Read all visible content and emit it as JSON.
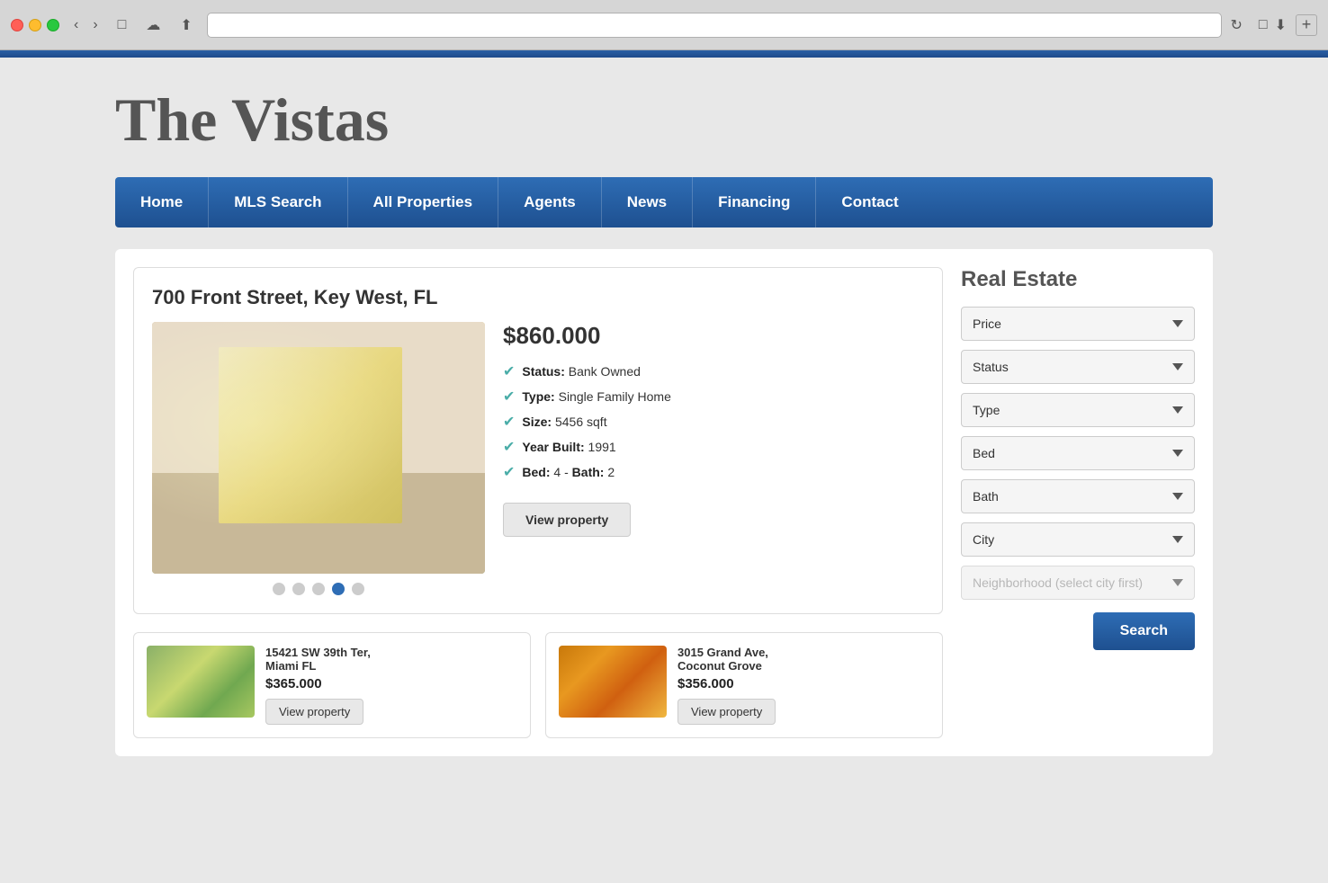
{
  "browser": {
    "address": ""
  },
  "site": {
    "title": "The Vistas"
  },
  "nav": {
    "items": [
      {
        "id": "home",
        "label": "Home"
      },
      {
        "id": "mls-search",
        "label": "MLS Search"
      },
      {
        "id": "all-properties",
        "label": "All Properties"
      },
      {
        "id": "agents",
        "label": "Agents"
      },
      {
        "id": "news",
        "label": "News"
      },
      {
        "id": "financing",
        "label": "Financing"
      },
      {
        "id": "contact",
        "label": "Contact"
      }
    ]
  },
  "sidebar": {
    "title": "Real Estate",
    "filters": [
      {
        "id": "price",
        "placeholder": "Price",
        "disabled": false
      },
      {
        "id": "status",
        "placeholder": "Status",
        "disabled": false
      },
      {
        "id": "type",
        "placeholder": "Type",
        "disabled": false
      },
      {
        "id": "bed",
        "placeholder": "Bed",
        "disabled": false
      },
      {
        "id": "bath",
        "placeholder": "Bath",
        "disabled": false
      },
      {
        "id": "city",
        "placeholder": "City",
        "disabled": false
      },
      {
        "id": "neighborhood",
        "placeholder": "Neighborhood (select city first)",
        "disabled": true
      }
    ],
    "search_button": "Search"
  },
  "featured": {
    "address": "700 Front Street, Key West, FL",
    "price": "$860.000",
    "status": "Bank Owned",
    "type": "Single Family Home",
    "size": "5456 sqft",
    "year_built": "1991",
    "bed": "4",
    "bath": "2",
    "view_btn": "View property",
    "dots": 5,
    "active_dot": 4
  },
  "property_cards": [
    {
      "address": "15421 SW 39th Ter,\nMiami FL",
      "price": "$365.000",
      "view_btn": "View property",
      "thumb_class": "card-thumb-1"
    },
    {
      "address": "3015 Grand Ave,\nCoconut Grove",
      "price": "$356.000",
      "view_btn": "View property",
      "thumb_class": "card-thumb-2"
    }
  ]
}
